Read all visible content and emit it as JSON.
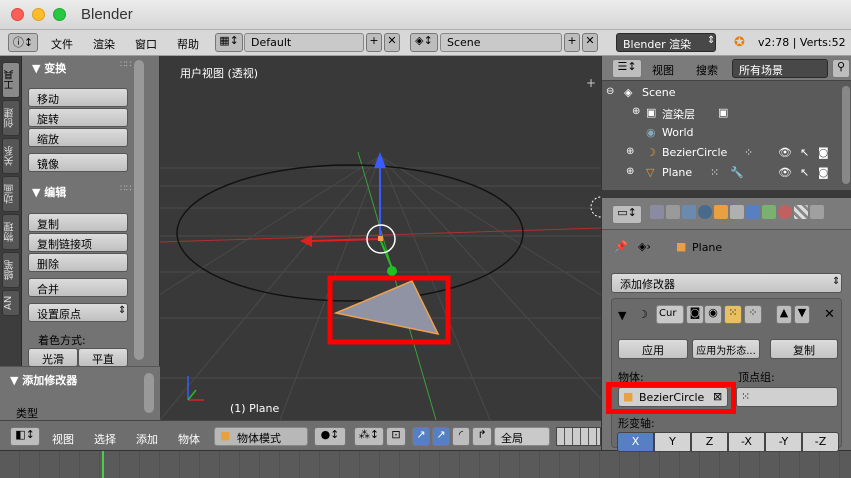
{
  "window": {
    "title": "Blender"
  },
  "menu": {
    "items": [
      "文件",
      "渲染",
      "窗口",
      "帮助"
    ]
  },
  "header": {
    "screen_layout": "Default",
    "scene": "Scene",
    "render_engine": "Blender 渲染",
    "version_stats": "v2:78 | Verts:52"
  },
  "tool_tabs": [
    "工具",
    "创建",
    "关系",
    "动画",
    "物理",
    "蜡笔",
    "AN"
  ],
  "toolshelf": {
    "transform_title": "▼ 变换",
    "transform_buttons": [
      "移动",
      "旋转",
      "缩放",
      "镜像"
    ],
    "edit_title": "▼ 编辑",
    "edit_buttons": [
      "复制",
      "复制链接项",
      "删除",
      "合并",
      "设置原点"
    ],
    "shading_label": "着色方式:",
    "shading_buttons": [
      "光滑",
      "平直"
    ],
    "modifier_title": "▼ 添加修改器",
    "type_label": "类型"
  },
  "viewport": {
    "title": "用户视图 (透视)",
    "object_label": "(1) Plane"
  },
  "viewport_header": {
    "menus": [
      "视图",
      "选择",
      "添加",
      "物体"
    ],
    "mode": "物体模式",
    "orientation": "全局"
  },
  "outliner": {
    "menus": [
      "视图",
      "搜索"
    ],
    "filter": "所有场景",
    "rows": [
      "Scene",
      "渲染层",
      "World",
      "BezierCircle",
      "Plane"
    ]
  },
  "properties": {
    "breadcrumb": "Plane",
    "add_modifier": "添加修改器",
    "modifier_name": "Cur",
    "apply_buttons": [
      "应用",
      "应用为形态...",
      "复制"
    ],
    "object_label": "物体:",
    "vertex_group_label": "顶点组:",
    "object_value": "BezierCircle",
    "deform_axis_label": "形变轴:",
    "axes": [
      "X",
      "Y",
      "Z",
      "-X",
      "-Y",
      "-Z"
    ]
  },
  "colors": {
    "highlight_red": "#ff0000",
    "selected_axis": "#5680c2",
    "plane_orange": "#f0a050"
  }
}
